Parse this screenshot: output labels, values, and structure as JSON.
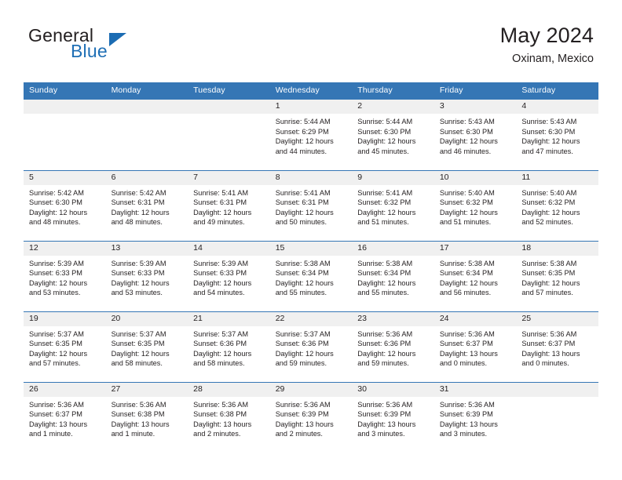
{
  "brand": {
    "name_top": "General",
    "name_bottom": "Blue",
    "accent_color": "#1b6cb3",
    "flag_icon": "triangle-flag-icon"
  },
  "header": {
    "title": "May 2024",
    "subtitle": "Oxinam, Mexico"
  },
  "colors": {
    "header_row_bg": "#3576b5",
    "header_row_text": "#ffffff",
    "daynum_bg": "#f0f0f0",
    "text": "#231f20",
    "row_divider": "#3576b5"
  },
  "calendar": {
    "weekday_headers": [
      "Sunday",
      "Monday",
      "Tuesday",
      "Wednesday",
      "Thursday",
      "Friday",
      "Saturday"
    ],
    "weeks": [
      [
        {
          "day": "",
          "lines": []
        },
        {
          "day": "",
          "lines": []
        },
        {
          "day": "",
          "lines": []
        },
        {
          "day": "1",
          "lines": [
            "Sunrise: 5:44 AM",
            "Sunset: 6:29 PM",
            "Daylight: 12 hours",
            "and 44 minutes."
          ]
        },
        {
          "day": "2",
          "lines": [
            "Sunrise: 5:44 AM",
            "Sunset: 6:30 PM",
            "Daylight: 12 hours",
            "and 45 minutes."
          ]
        },
        {
          "day": "3",
          "lines": [
            "Sunrise: 5:43 AM",
            "Sunset: 6:30 PM",
            "Daylight: 12 hours",
            "and 46 minutes."
          ]
        },
        {
          "day": "4",
          "lines": [
            "Sunrise: 5:43 AM",
            "Sunset: 6:30 PM",
            "Daylight: 12 hours",
            "and 47 minutes."
          ]
        }
      ],
      [
        {
          "day": "5",
          "lines": [
            "Sunrise: 5:42 AM",
            "Sunset: 6:30 PM",
            "Daylight: 12 hours",
            "and 48 minutes."
          ]
        },
        {
          "day": "6",
          "lines": [
            "Sunrise: 5:42 AM",
            "Sunset: 6:31 PM",
            "Daylight: 12 hours",
            "and 48 minutes."
          ]
        },
        {
          "day": "7",
          "lines": [
            "Sunrise: 5:41 AM",
            "Sunset: 6:31 PM",
            "Daylight: 12 hours",
            "and 49 minutes."
          ]
        },
        {
          "day": "8",
          "lines": [
            "Sunrise: 5:41 AM",
            "Sunset: 6:31 PM",
            "Daylight: 12 hours",
            "and 50 minutes."
          ]
        },
        {
          "day": "9",
          "lines": [
            "Sunrise: 5:41 AM",
            "Sunset: 6:32 PM",
            "Daylight: 12 hours",
            "and 51 minutes."
          ]
        },
        {
          "day": "10",
          "lines": [
            "Sunrise: 5:40 AM",
            "Sunset: 6:32 PM",
            "Daylight: 12 hours",
            "and 51 minutes."
          ]
        },
        {
          "day": "11",
          "lines": [
            "Sunrise: 5:40 AM",
            "Sunset: 6:32 PM",
            "Daylight: 12 hours",
            "and 52 minutes."
          ]
        }
      ],
      [
        {
          "day": "12",
          "lines": [
            "Sunrise: 5:39 AM",
            "Sunset: 6:33 PM",
            "Daylight: 12 hours",
            "and 53 minutes."
          ]
        },
        {
          "day": "13",
          "lines": [
            "Sunrise: 5:39 AM",
            "Sunset: 6:33 PM",
            "Daylight: 12 hours",
            "and 53 minutes."
          ]
        },
        {
          "day": "14",
          "lines": [
            "Sunrise: 5:39 AM",
            "Sunset: 6:33 PM",
            "Daylight: 12 hours",
            "and 54 minutes."
          ]
        },
        {
          "day": "15",
          "lines": [
            "Sunrise: 5:38 AM",
            "Sunset: 6:34 PM",
            "Daylight: 12 hours",
            "and 55 minutes."
          ]
        },
        {
          "day": "16",
          "lines": [
            "Sunrise: 5:38 AM",
            "Sunset: 6:34 PM",
            "Daylight: 12 hours",
            "and 55 minutes."
          ]
        },
        {
          "day": "17",
          "lines": [
            "Sunrise: 5:38 AM",
            "Sunset: 6:34 PM",
            "Daylight: 12 hours",
            "and 56 minutes."
          ]
        },
        {
          "day": "18",
          "lines": [
            "Sunrise: 5:38 AM",
            "Sunset: 6:35 PM",
            "Daylight: 12 hours",
            "and 57 minutes."
          ]
        }
      ],
      [
        {
          "day": "19",
          "lines": [
            "Sunrise: 5:37 AM",
            "Sunset: 6:35 PM",
            "Daylight: 12 hours",
            "and 57 minutes."
          ]
        },
        {
          "day": "20",
          "lines": [
            "Sunrise: 5:37 AM",
            "Sunset: 6:35 PM",
            "Daylight: 12 hours",
            "and 58 minutes."
          ]
        },
        {
          "day": "21",
          "lines": [
            "Sunrise: 5:37 AM",
            "Sunset: 6:36 PM",
            "Daylight: 12 hours",
            "and 58 minutes."
          ]
        },
        {
          "day": "22",
          "lines": [
            "Sunrise: 5:37 AM",
            "Sunset: 6:36 PM",
            "Daylight: 12 hours",
            "and 59 minutes."
          ]
        },
        {
          "day": "23",
          "lines": [
            "Sunrise: 5:36 AM",
            "Sunset: 6:36 PM",
            "Daylight: 12 hours",
            "and 59 minutes."
          ]
        },
        {
          "day": "24",
          "lines": [
            "Sunrise: 5:36 AM",
            "Sunset: 6:37 PM",
            "Daylight: 13 hours",
            "and 0 minutes."
          ]
        },
        {
          "day": "25",
          "lines": [
            "Sunrise: 5:36 AM",
            "Sunset: 6:37 PM",
            "Daylight: 13 hours",
            "and 0 minutes."
          ]
        }
      ],
      [
        {
          "day": "26",
          "lines": [
            "Sunrise: 5:36 AM",
            "Sunset: 6:37 PM",
            "Daylight: 13 hours",
            "and 1 minute."
          ]
        },
        {
          "day": "27",
          "lines": [
            "Sunrise: 5:36 AM",
            "Sunset: 6:38 PM",
            "Daylight: 13 hours",
            "and 1 minute."
          ]
        },
        {
          "day": "28",
          "lines": [
            "Sunrise: 5:36 AM",
            "Sunset: 6:38 PM",
            "Daylight: 13 hours",
            "and 2 minutes."
          ]
        },
        {
          "day": "29",
          "lines": [
            "Sunrise: 5:36 AM",
            "Sunset: 6:39 PM",
            "Daylight: 13 hours",
            "and 2 minutes."
          ]
        },
        {
          "day": "30",
          "lines": [
            "Sunrise: 5:36 AM",
            "Sunset: 6:39 PM",
            "Daylight: 13 hours",
            "and 3 minutes."
          ]
        },
        {
          "day": "31",
          "lines": [
            "Sunrise: 5:36 AM",
            "Sunset: 6:39 PM",
            "Daylight: 13 hours",
            "and 3 minutes."
          ]
        },
        {
          "day": "",
          "lines": []
        }
      ]
    ]
  }
}
